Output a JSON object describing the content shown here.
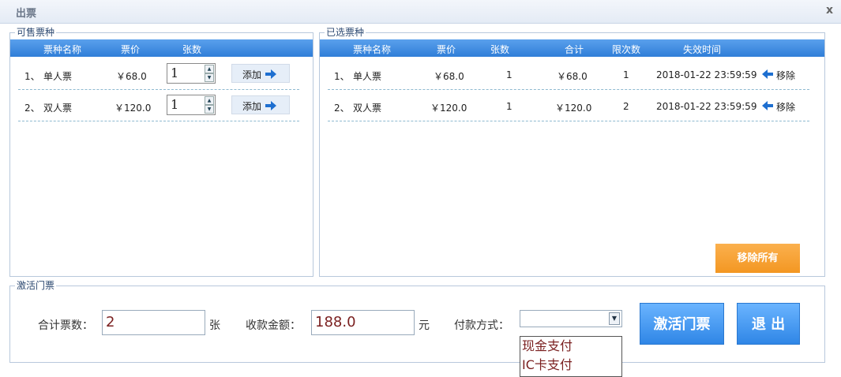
{
  "window": {
    "title": "出票",
    "close": "x"
  },
  "available": {
    "legend": "可售票种",
    "headers": {
      "name": "票种名称",
      "price": "票价",
      "count": "张数"
    },
    "rows": [
      {
        "index": "1、",
        "name": "单人票",
        "price": "￥68.0",
        "qty": "1",
        "add_label": "添加"
      },
      {
        "index": "2、",
        "name": "双人票",
        "price": "￥120.0",
        "qty": "1",
        "add_label": "添加"
      }
    ]
  },
  "selected": {
    "legend": "已选票种",
    "headers": {
      "name": "票种名称",
      "price": "票价",
      "count": "张数",
      "total": "合计",
      "limit": "限次数",
      "expire": "失效时间"
    },
    "rows": [
      {
        "index": "1、",
        "name": "单人票",
        "price": "￥68.0",
        "count": "1",
        "total": "￥68.0",
        "limit": "1",
        "expire": "2018-01-22 23:59:59",
        "remove_label": "移除"
      },
      {
        "index": "2、",
        "name": "双人票",
        "price": "￥120.0",
        "count": "1",
        "total": "￥120.0",
        "limit": "2",
        "expire": "2018-01-22 23:59:59",
        "remove_label": "移除"
      }
    ],
    "remove_all_label": "移除所有"
  },
  "activate": {
    "legend": "激活门票",
    "total_count_label": "合计票数：",
    "total_count_value": "2",
    "total_count_unit": "张",
    "amount_label": "收款金额：",
    "amount_value": "188.0",
    "amount_unit": "元",
    "payment_label": "付款方式：",
    "payment_options": [
      "现金支付",
      "IC卡支付"
    ],
    "activate_button": "激活门票",
    "exit_button": "退 出"
  },
  "colors": {
    "header_blue": "#2f7ed8",
    "orange": "#f39722",
    "value_red": "#7a1f1f"
  }
}
